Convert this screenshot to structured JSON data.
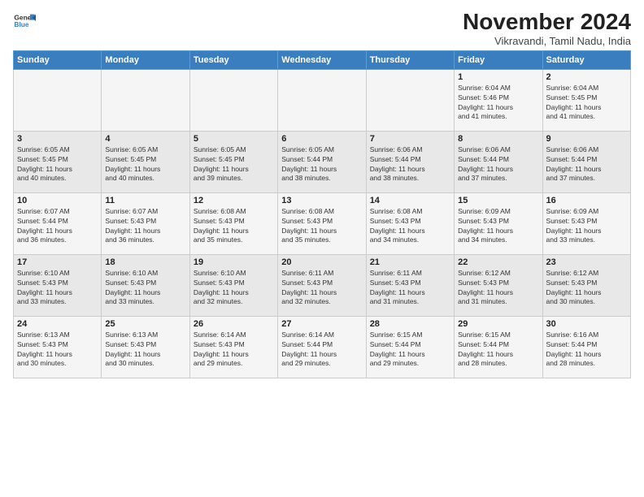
{
  "logo": {
    "general": "General",
    "blue": "Blue"
  },
  "title": "November 2024",
  "subtitle": "Vikravandi, Tamil Nadu, India",
  "headers": [
    "Sunday",
    "Monday",
    "Tuesday",
    "Wednesday",
    "Thursday",
    "Friday",
    "Saturday"
  ],
  "weeks": [
    [
      {
        "day": "",
        "info": ""
      },
      {
        "day": "",
        "info": ""
      },
      {
        "day": "",
        "info": ""
      },
      {
        "day": "",
        "info": ""
      },
      {
        "day": "",
        "info": ""
      },
      {
        "day": "1",
        "info": "Sunrise: 6:04 AM\nSunset: 5:46 PM\nDaylight: 11 hours\nand 41 minutes."
      },
      {
        "day": "2",
        "info": "Sunrise: 6:04 AM\nSunset: 5:45 PM\nDaylight: 11 hours\nand 41 minutes."
      }
    ],
    [
      {
        "day": "3",
        "info": "Sunrise: 6:05 AM\nSunset: 5:45 PM\nDaylight: 11 hours\nand 40 minutes."
      },
      {
        "day": "4",
        "info": "Sunrise: 6:05 AM\nSunset: 5:45 PM\nDaylight: 11 hours\nand 40 minutes."
      },
      {
        "day": "5",
        "info": "Sunrise: 6:05 AM\nSunset: 5:45 PM\nDaylight: 11 hours\nand 39 minutes."
      },
      {
        "day": "6",
        "info": "Sunrise: 6:05 AM\nSunset: 5:44 PM\nDaylight: 11 hours\nand 38 minutes."
      },
      {
        "day": "7",
        "info": "Sunrise: 6:06 AM\nSunset: 5:44 PM\nDaylight: 11 hours\nand 38 minutes."
      },
      {
        "day": "8",
        "info": "Sunrise: 6:06 AM\nSunset: 5:44 PM\nDaylight: 11 hours\nand 37 minutes."
      },
      {
        "day": "9",
        "info": "Sunrise: 6:06 AM\nSunset: 5:44 PM\nDaylight: 11 hours\nand 37 minutes."
      }
    ],
    [
      {
        "day": "10",
        "info": "Sunrise: 6:07 AM\nSunset: 5:44 PM\nDaylight: 11 hours\nand 36 minutes."
      },
      {
        "day": "11",
        "info": "Sunrise: 6:07 AM\nSunset: 5:43 PM\nDaylight: 11 hours\nand 36 minutes."
      },
      {
        "day": "12",
        "info": "Sunrise: 6:08 AM\nSunset: 5:43 PM\nDaylight: 11 hours\nand 35 minutes."
      },
      {
        "day": "13",
        "info": "Sunrise: 6:08 AM\nSunset: 5:43 PM\nDaylight: 11 hours\nand 35 minutes."
      },
      {
        "day": "14",
        "info": "Sunrise: 6:08 AM\nSunset: 5:43 PM\nDaylight: 11 hours\nand 34 minutes."
      },
      {
        "day": "15",
        "info": "Sunrise: 6:09 AM\nSunset: 5:43 PM\nDaylight: 11 hours\nand 34 minutes."
      },
      {
        "day": "16",
        "info": "Sunrise: 6:09 AM\nSunset: 5:43 PM\nDaylight: 11 hours\nand 33 minutes."
      }
    ],
    [
      {
        "day": "17",
        "info": "Sunrise: 6:10 AM\nSunset: 5:43 PM\nDaylight: 11 hours\nand 33 minutes."
      },
      {
        "day": "18",
        "info": "Sunrise: 6:10 AM\nSunset: 5:43 PM\nDaylight: 11 hours\nand 33 minutes."
      },
      {
        "day": "19",
        "info": "Sunrise: 6:10 AM\nSunset: 5:43 PM\nDaylight: 11 hours\nand 32 minutes."
      },
      {
        "day": "20",
        "info": "Sunrise: 6:11 AM\nSunset: 5:43 PM\nDaylight: 11 hours\nand 32 minutes."
      },
      {
        "day": "21",
        "info": "Sunrise: 6:11 AM\nSunset: 5:43 PM\nDaylight: 11 hours\nand 31 minutes."
      },
      {
        "day": "22",
        "info": "Sunrise: 6:12 AM\nSunset: 5:43 PM\nDaylight: 11 hours\nand 31 minutes."
      },
      {
        "day": "23",
        "info": "Sunrise: 6:12 AM\nSunset: 5:43 PM\nDaylight: 11 hours\nand 30 minutes."
      }
    ],
    [
      {
        "day": "24",
        "info": "Sunrise: 6:13 AM\nSunset: 5:43 PM\nDaylight: 11 hours\nand 30 minutes."
      },
      {
        "day": "25",
        "info": "Sunrise: 6:13 AM\nSunset: 5:43 PM\nDaylight: 11 hours\nand 30 minutes."
      },
      {
        "day": "26",
        "info": "Sunrise: 6:14 AM\nSunset: 5:43 PM\nDaylight: 11 hours\nand 29 minutes."
      },
      {
        "day": "27",
        "info": "Sunrise: 6:14 AM\nSunset: 5:44 PM\nDaylight: 11 hours\nand 29 minutes."
      },
      {
        "day": "28",
        "info": "Sunrise: 6:15 AM\nSunset: 5:44 PM\nDaylight: 11 hours\nand 29 minutes."
      },
      {
        "day": "29",
        "info": "Sunrise: 6:15 AM\nSunset: 5:44 PM\nDaylight: 11 hours\nand 28 minutes."
      },
      {
        "day": "30",
        "info": "Sunrise: 6:16 AM\nSunset: 5:44 PM\nDaylight: 11 hours\nand 28 minutes."
      }
    ]
  ]
}
